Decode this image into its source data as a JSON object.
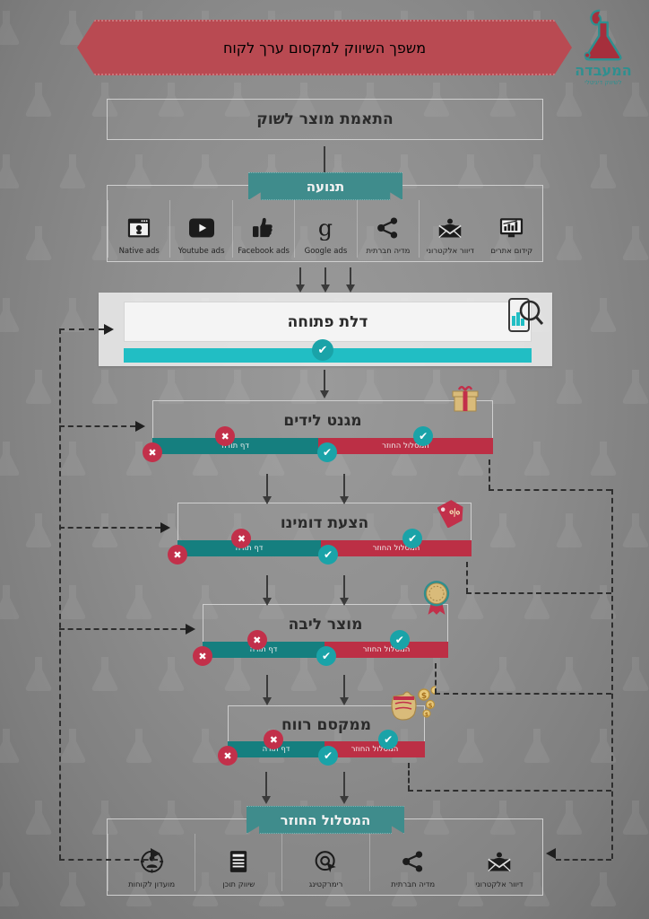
{
  "title": "משפך השיווק למקסום ערך לקוח",
  "logo": {
    "name": "המעבדה",
    "subtitle": "לשיווק דיגיטלי",
    "icon": "flask-icon"
  },
  "product_market_fit": {
    "label": "התאמת מוצר לשוק"
  },
  "traffic": {
    "ribbon_label": "תנועה",
    "channels": [
      {
        "label": "Native ads",
        "icon": "browser-window-icon"
      },
      {
        "label": "Youtube ads",
        "icon": "youtube-play-icon"
      },
      {
        "label": "Facebook ads",
        "icon": "thumbs-up-icon"
      },
      {
        "label": "Google ads",
        "icon": "google-g-icon"
      },
      {
        "label": "מדיה חברתית",
        "icon": "share-nodes-icon"
      },
      {
        "label": "דיוור אלקטרוני",
        "icon": "email-person-icon"
      },
      {
        "label": "קידום אתרים",
        "icon": "monitor-chart-icon"
      }
    ]
  },
  "open_door": {
    "label": "דלת פתוחה",
    "icon": "phone-search-icon",
    "check": "✔"
  },
  "stages": [
    {
      "label": "מגנט לידים",
      "teal_label": "דף תודה",
      "red_label": "המסלול החוזר",
      "decoration": "gift-box-icon"
    },
    {
      "label": "הצעת דומינו",
      "teal_label": "דף תודה",
      "red_label": "המסלול החוזר",
      "decoration": "discount-tag-icon"
    },
    {
      "label": "מוצר ליבה",
      "teal_label": "דף תודה",
      "red_label": "המסלול החוזר",
      "decoration": "award-rosette-icon"
    },
    {
      "label": "ממקסם רווח",
      "teal_label": "דף תודה",
      "red_label": "המסלול החוזר",
      "decoration": "money-bag-coins-icon"
    }
  ],
  "marks": {
    "ok": "✔",
    "no": "✖"
  },
  "return_path": {
    "ribbon_label": "המסלול החוזר",
    "channels": [
      {
        "label": "מועדון לקוחות",
        "icon": "customer-club-icon"
      },
      {
        "label": "שיווק תוכן",
        "icon": "content-document-icon"
      },
      {
        "label": "רימרקטינג",
        "icon": "retargeting-cursor-icon"
      },
      {
        "label": "מדיה חברתית",
        "icon": "share-nodes-icon"
      },
      {
        "label": "דיוור אלקטרוני",
        "icon": "email-person-icon"
      }
    ]
  },
  "colors": {
    "banner_red": "#b94a52",
    "teal_ribbon": "#3f8c8c",
    "teal_bar": "#157f7f",
    "teal_bright": "#21bec4",
    "red_bar": "#bc2f45",
    "background": "#8b8b8b"
  }
}
